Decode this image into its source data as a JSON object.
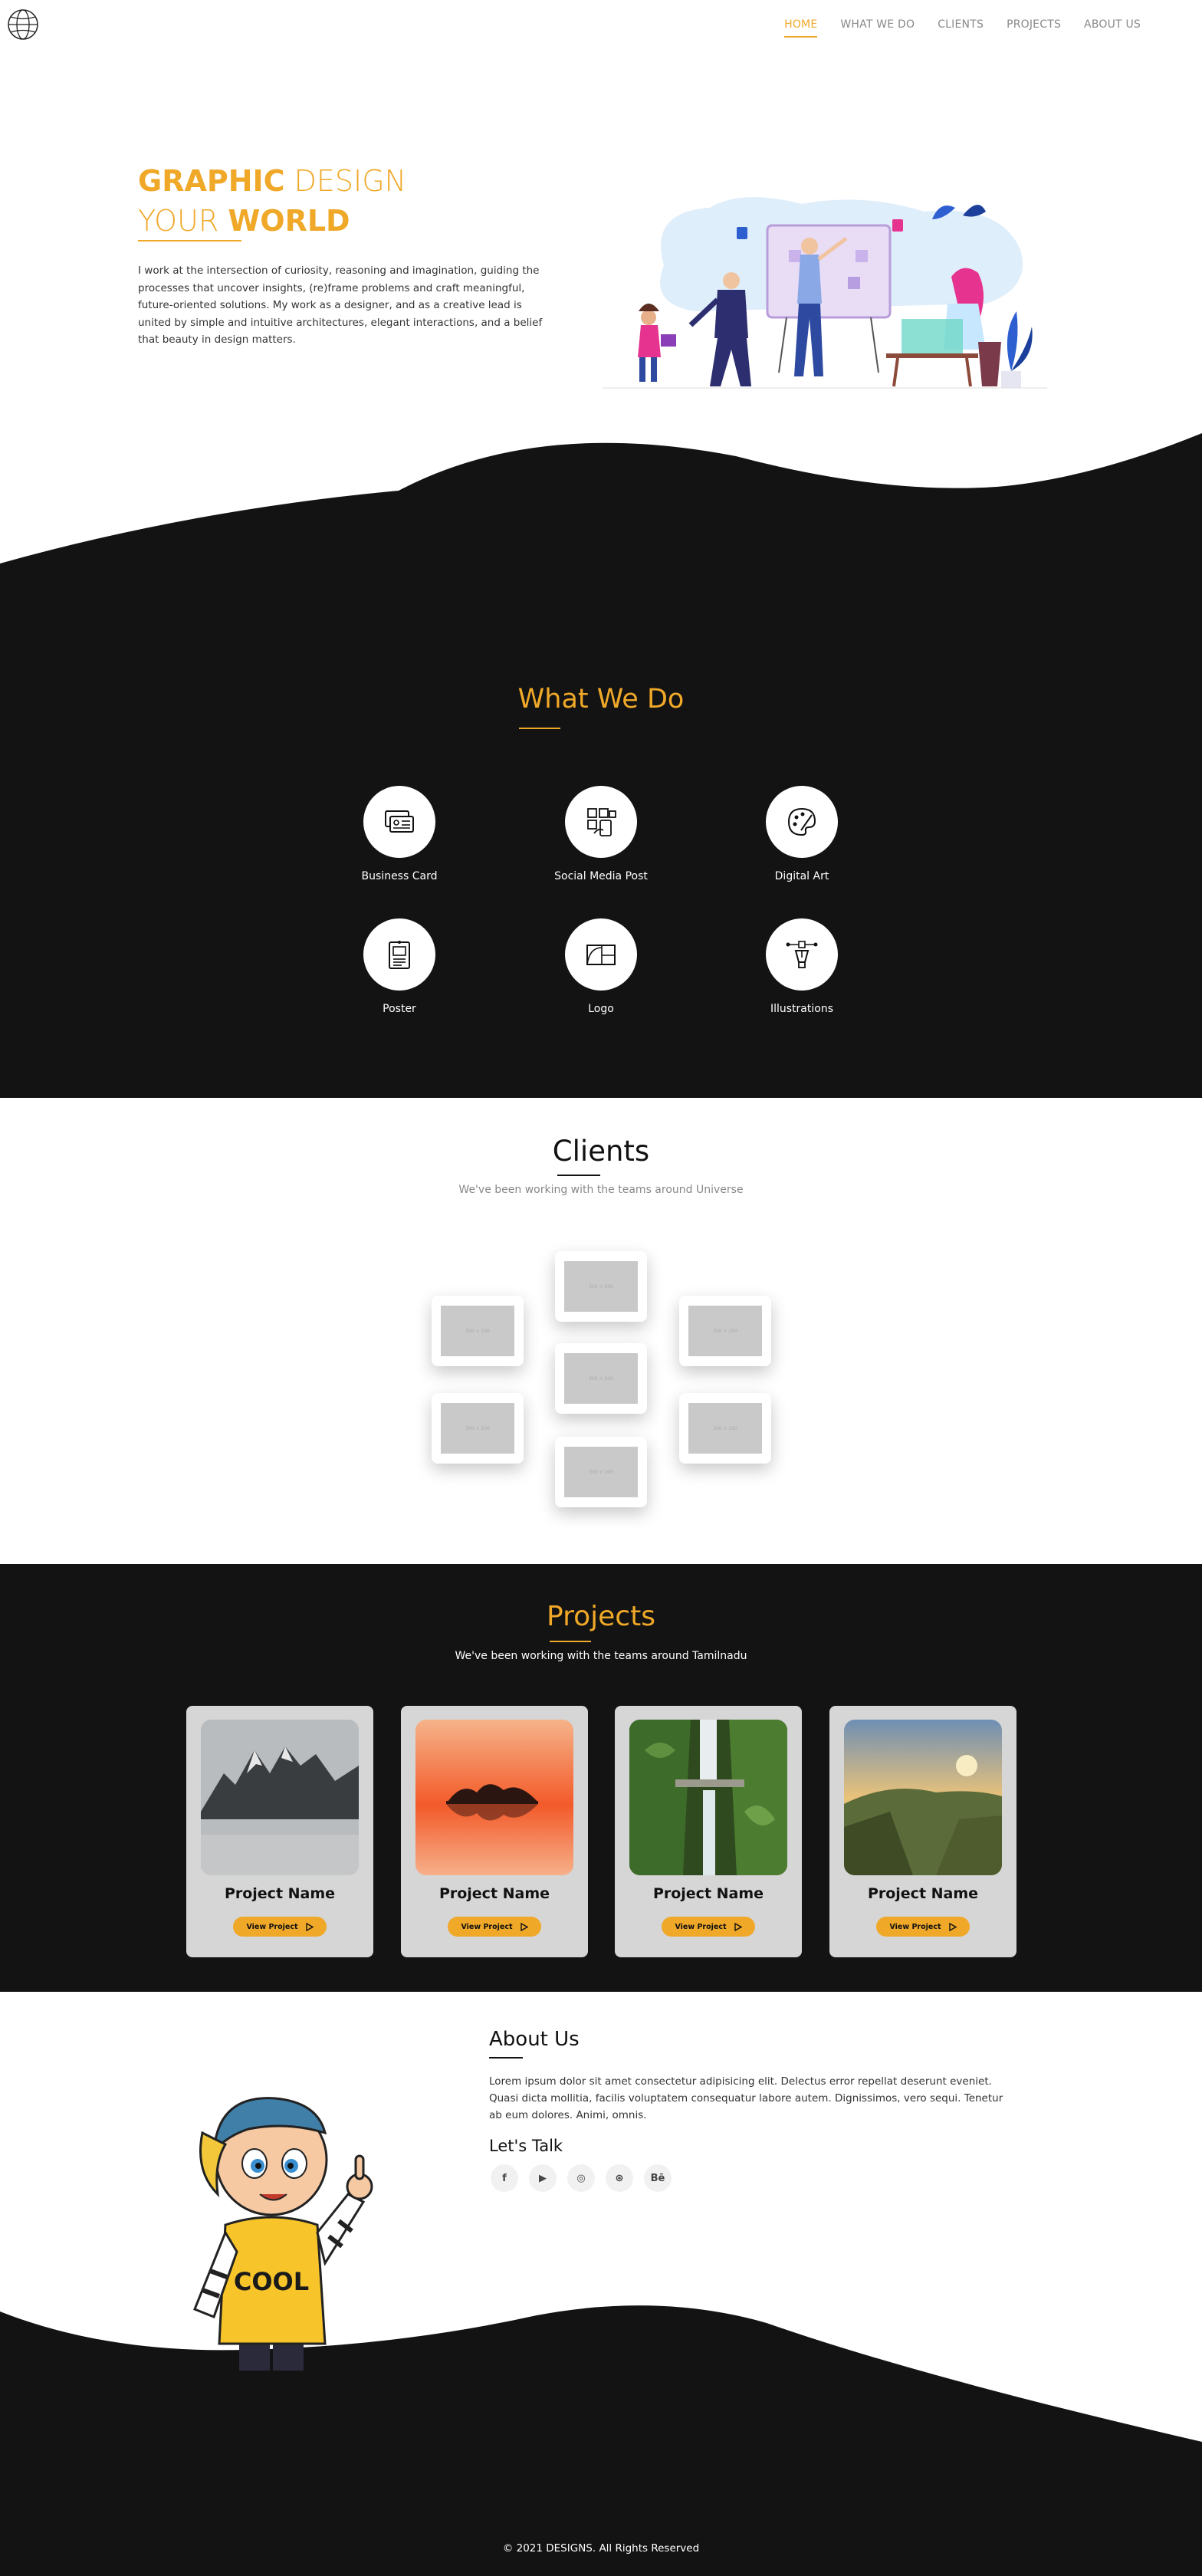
{
  "nav": {
    "items": [
      {
        "label": "HOME",
        "active": true
      },
      {
        "label": "WHAT WE DO",
        "active": false
      },
      {
        "label": "CLIENTS",
        "active": false
      },
      {
        "label": "PROJECTS",
        "active": false
      },
      {
        "label": "ABOUT US",
        "active": false
      }
    ]
  },
  "hero": {
    "title_bold_1": "GRAPHIC",
    "title_light_1": " DESIGN",
    "title_light_2": "YOUR ",
    "title_bold_2": "WORLD",
    "text": "I work at the intersection of curiosity, reasoning and imagination, guiding the processes that uncover insights, (re)frame problems and craft meaningful, future-oriented solutions. My work as a designer, and as a creative lead is united by simple and intuitive architectures, elegant interactions, and a belief that beauty in design matters."
  },
  "what_we_do": {
    "title": "What We Do",
    "services": [
      {
        "label": "Business Card",
        "icon": "business-card-icon"
      },
      {
        "label": "Social Media Post",
        "icon": "social-media-icon"
      },
      {
        "label": "Digital Art",
        "icon": "palette-icon"
      },
      {
        "label": "Poster",
        "icon": "poster-icon"
      },
      {
        "label": "Logo",
        "icon": "logo-design-icon"
      },
      {
        "label": "Illustrations",
        "icon": "pen-tool-icon"
      }
    ]
  },
  "clients": {
    "title": "Clients",
    "subtitle": "We've been working with the teams around Universe",
    "placeholder": "300 × 200"
  },
  "projects": {
    "title": "Projects",
    "subtitle": "We've been working with the teams around Tamilnadu",
    "items": [
      {
        "name": "Project Name",
        "button": "View Project"
      },
      {
        "name": "Project Name",
        "button": "View Project"
      },
      {
        "name": "Project Name",
        "button": "View Project"
      },
      {
        "name": "Project Name",
        "button": "View Project"
      }
    ]
  },
  "about": {
    "title": "About Us",
    "text": "Lorem ipsum dolor sit amet consectetur adipisicing elit. Delectus error repellat deserunt eveniet. Quasi dicta mollitia, facilis voluptatem consequatur labore autem. Dignissimos, vero sequi. Tenetur ab eum dolores. Animi, omnis.",
    "talk_title": "Let's Talk",
    "socials": [
      {
        "label": "f",
        "icon": "facebook-icon"
      },
      {
        "label": "▶",
        "icon": "youtube-icon"
      },
      {
        "label": "◎",
        "icon": "instagram-icon"
      },
      {
        "label": "⊛",
        "icon": "dribbble-icon"
      },
      {
        "label": "Bē",
        "icon": "behance-icon"
      }
    ],
    "boy_shirt_text": "COOL"
  },
  "footer": {
    "text": "© 2021 DESIGNS. All Rights Reserved"
  },
  "colors": {
    "accent": "#f0a828",
    "dark": "#131313"
  }
}
